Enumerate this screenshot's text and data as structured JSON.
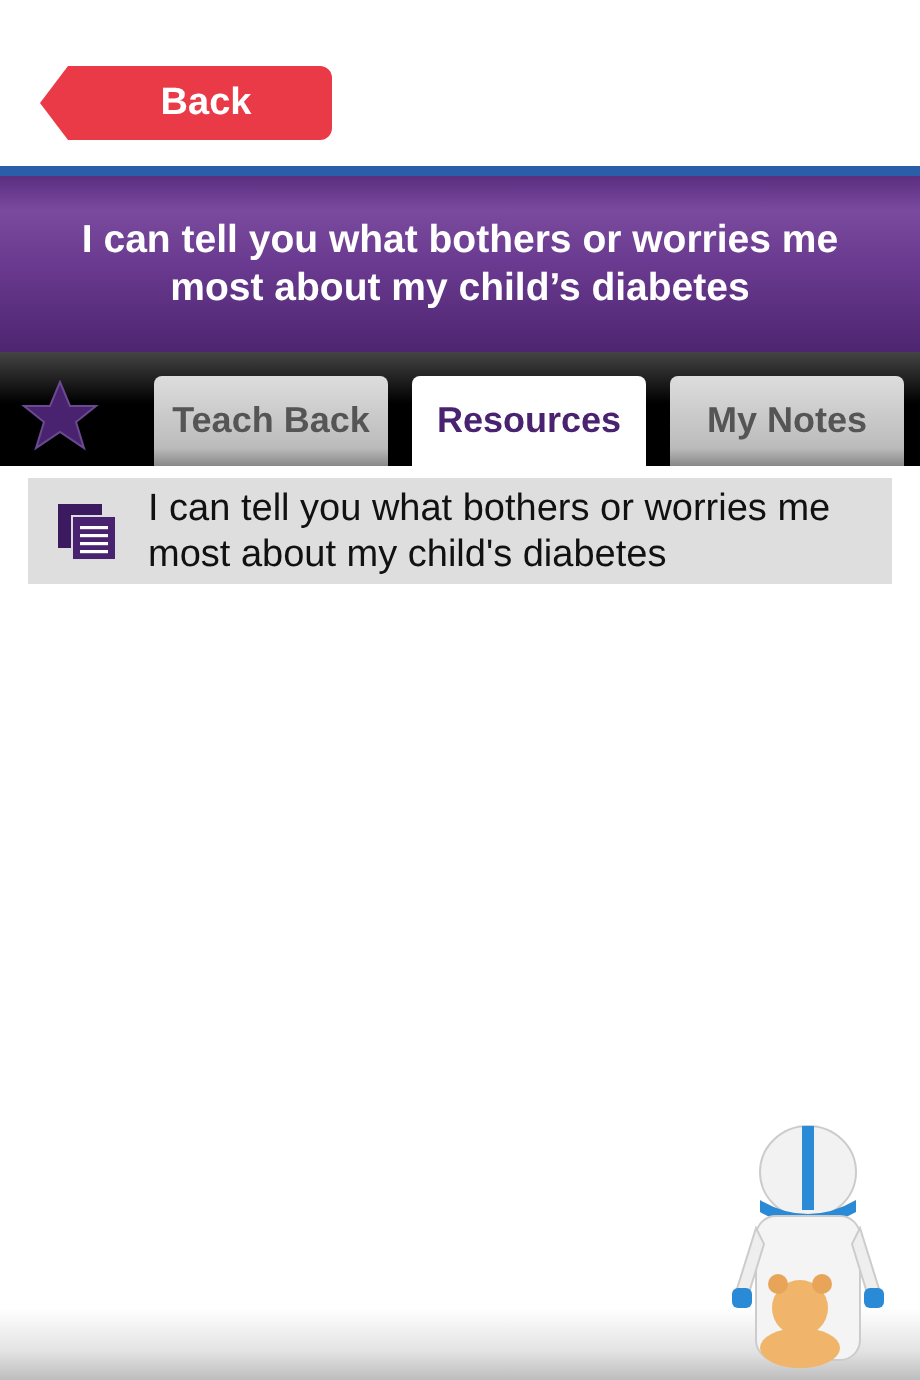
{
  "back_button": {
    "label": "Back"
  },
  "header": {
    "title": "I can tell you what bothers or worries me most about my child’s diabetes"
  },
  "tabs": [
    {
      "label": "Teach Back",
      "selected": false
    },
    {
      "label": "Resources",
      "selected": true
    },
    {
      "label": "My Notes",
      "selected": false
    }
  ],
  "resources": [
    {
      "title": "I can tell you what bothers or worries me most about my child's diabetes"
    }
  ]
}
